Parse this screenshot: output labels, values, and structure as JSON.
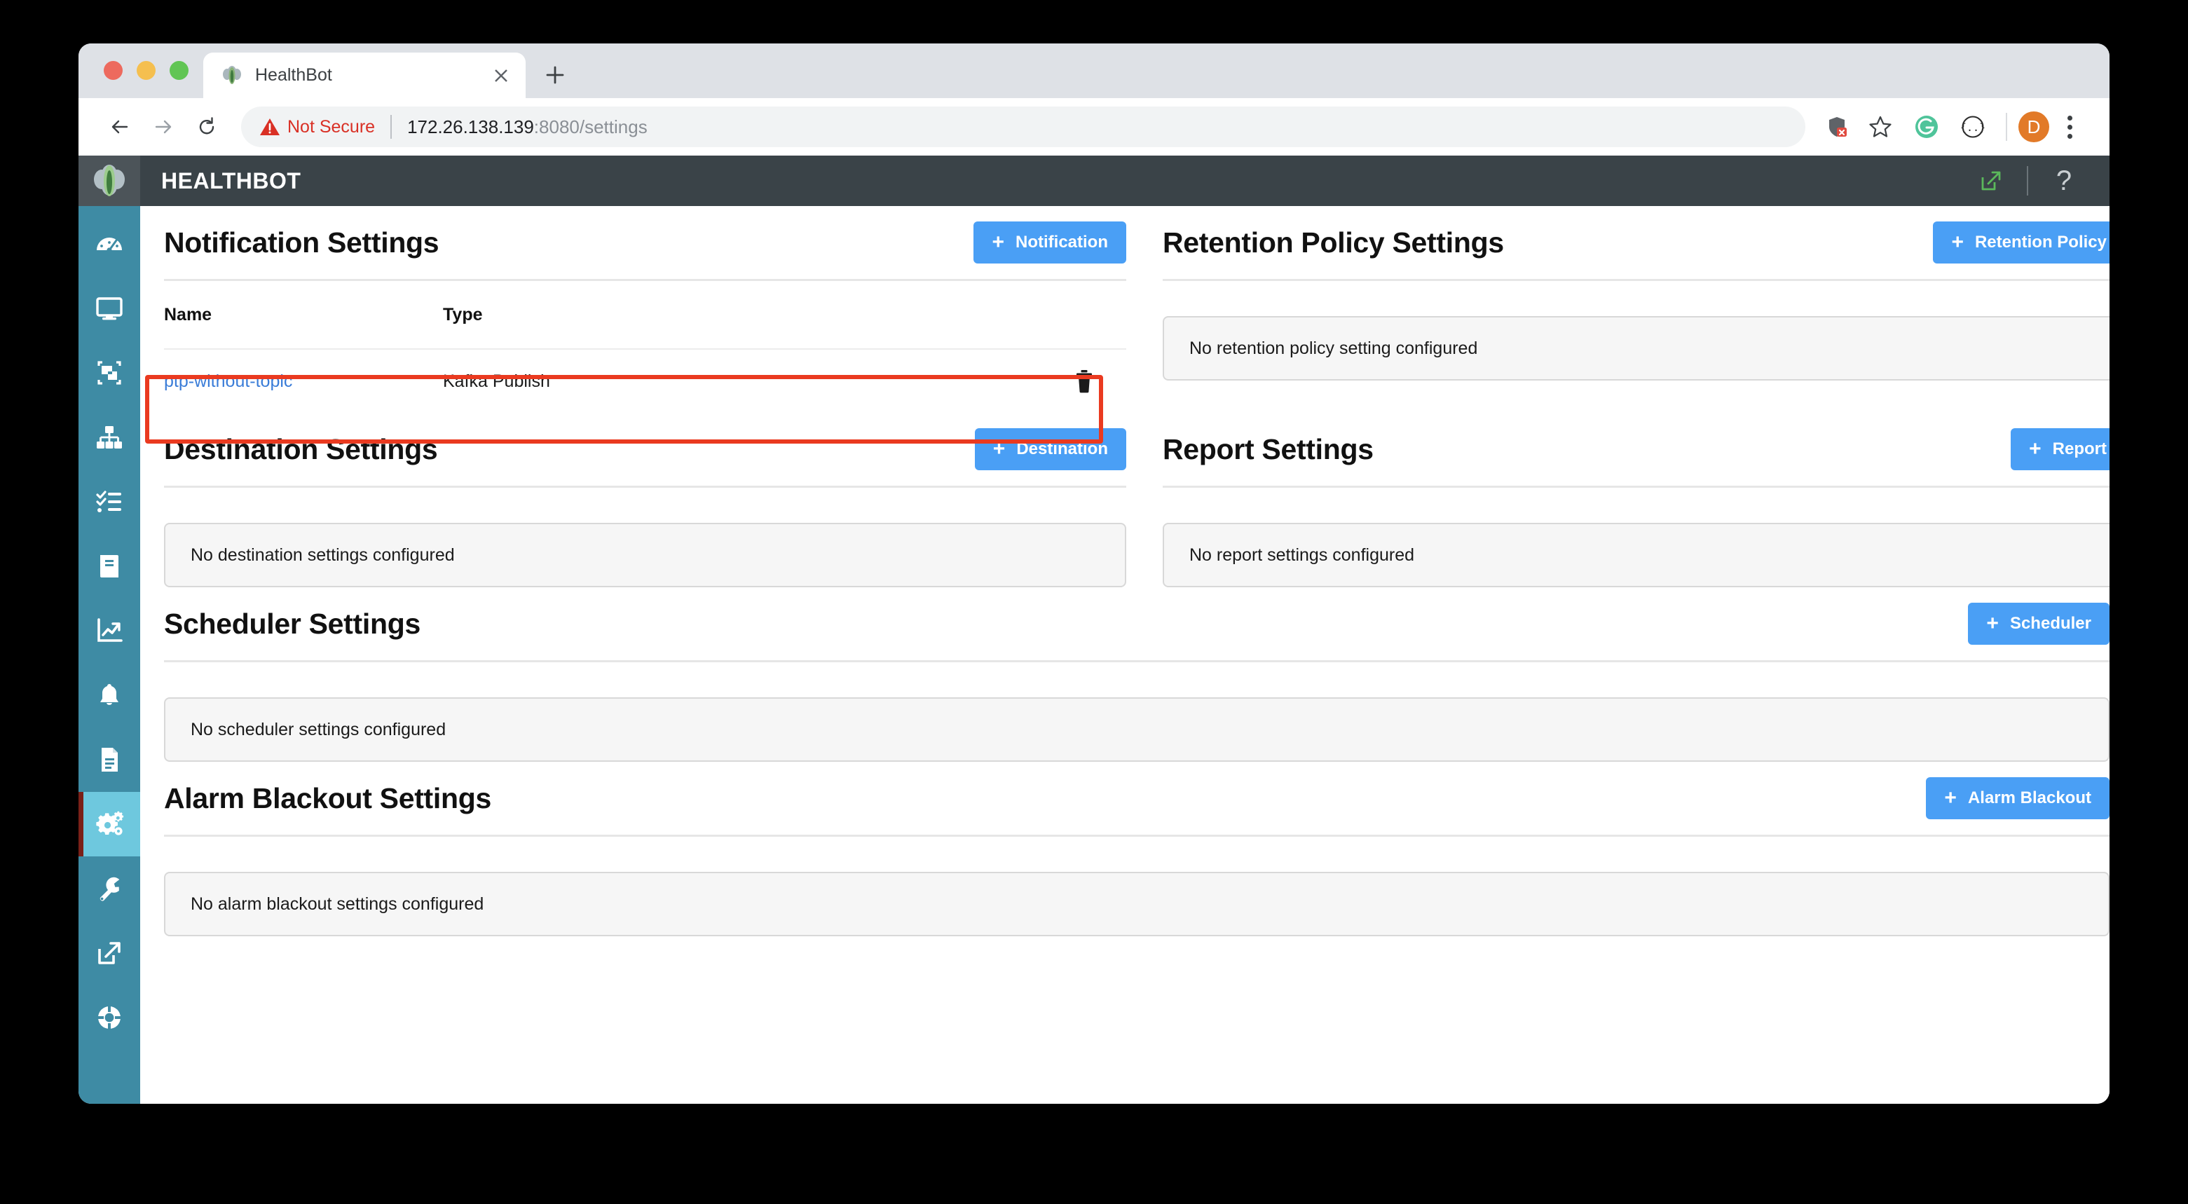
{
  "browser": {
    "tab": {
      "title": "HealthBot",
      "favicon_icon": "juniper-logo-icon",
      "close_icon": "close-icon"
    },
    "new_tab_icon": "plus-icon",
    "back_icon": "back-arrow-icon",
    "forward_icon": "forward-arrow-icon",
    "reload_icon": "reload-icon",
    "security": {
      "warning_icon": "warning-triangle-icon",
      "label": "Not Secure"
    },
    "url": {
      "host": "172.26.138.139",
      "rest": ":8080/settings"
    },
    "extensions": [
      {
        "name": "shield-blocked-icon"
      },
      {
        "name": "bookmark-star-icon"
      },
      {
        "name": "grammarly-icon"
      },
      {
        "name": "json-formatter-icon"
      }
    ],
    "profile": {
      "initial": "D"
    },
    "menu_icon": "three-dot-menu-icon"
  },
  "app_header": {
    "brand": "HEALTHBOT",
    "logo_icon": "healthbot-logo-icon",
    "external_link_icon": "external-link-icon",
    "help_label": "?"
  },
  "sidebar": {
    "items": [
      {
        "name": "dashboard",
        "icon": "gauge-icon",
        "active": false
      },
      {
        "name": "monitor",
        "icon": "monitor-icon",
        "active": false
      },
      {
        "name": "device-group",
        "icon": "device-group-icon",
        "active": false
      },
      {
        "name": "network-topology",
        "icon": "network-topology-icon",
        "active": false
      },
      {
        "name": "tasks",
        "icon": "checklist-icon",
        "active": false
      },
      {
        "name": "library",
        "icon": "book-icon",
        "active": false
      },
      {
        "name": "analytics",
        "icon": "chart-up-icon",
        "active": false
      },
      {
        "name": "alarms",
        "icon": "bell-icon",
        "active": false
      },
      {
        "name": "reports",
        "icon": "document-icon",
        "active": false
      },
      {
        "name": "settings",
        "icon": "gears-icon",
        "active": true
      },
      {
        "name": "administration",
        "icon": "wrench-icon",
        "active": false
      },
      {
        "name": "open-external",
        "icon": "external-link-icon",
        "active": false
      },
      {
        "name": "support",
        "icon": "life-ring-icon",
        "active": false
      }
    ]
  },
  "sections": {
    "notification": {
      "title": "Notification Settings",
      "button": {
        "label": "Notification",
        "plus": "+"
      },
      "columns": {
        "name": "Name",
        "type": "Type"
      },
      "rows": [
        {
          "name": "ptp-without-topic",
          "type": "Kafka Publish",
          "delete_icon": "trash-icon"
        }
      ]
    },
    "retention": {
      "title": "Retention Policy Settings",
      "button": {
        "label": "Retention Policy",
        "plus": "+"
      },
      "empty": "No retention policy setting configured"
    },
    "destination": {
      "title": "Destination Settings",
      "button": {
        "label": "Destination",
        "plus": "+"
      },
      "empty": "No destination settings configured"
    },
    "report": {
      "title": "Report Settings",
      "button": {
        "label": "Report",
        "plus": "+"
      },
      "empty": "No report settings configured"
    },
    "scheduler": {
      "title": "Scheduler Settings",
      "button": {
        "label": "Scheduler",
        "plus": "+"
      },
      "empty": "No scheduler settings configured"
    },
    "alarm_blackout": {
      "title": "Alarm Blackout Settings",
      "button": {
        "label": "Alarm Blackout",
        "plus": "+"
      },
      "empty": "No alarm blackout settings configured"
    }
  },
  "annotation": {
    "highlight_color": "#ea3a20",
    "target": "notification-row-ptp-without-topic"
  },
  "colors": {
    "accent_blue": "#4a9ff5",
    "sidebar": "#3e8ba4",
    "sidebar_active": "#6ec8de",
    "app_header": "#3a4348",
    "link": "#3b7dd8",
    "not_secure": "#d93025"
  }
}
